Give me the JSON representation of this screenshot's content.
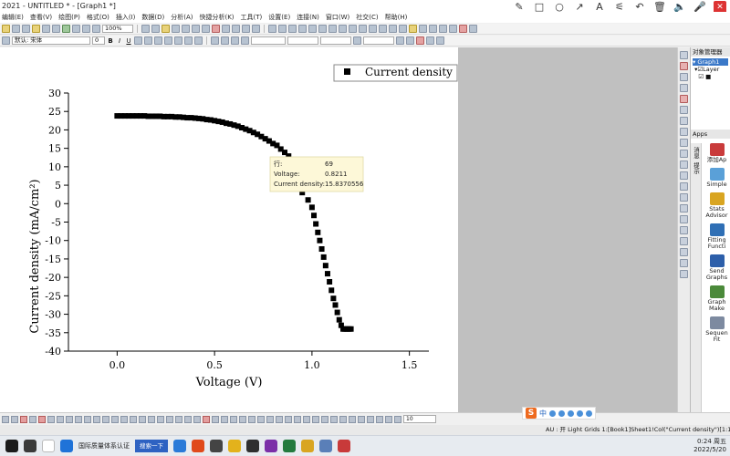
{
  "window": {
    "title": "2021 - UNTITLED * - [Graph1 *]"
  },
  "menu": [
    "编辑(E)",
    "查看(V)",
    "绘图(P)",
    "格式(O)",
    "插入(I)",
    "数据(D)",
    "分析(A)",
    "快捷分析(K)",
    "工具(T)",
    "设置(E)",
    "连接(N)",
    "窗口(W)",
    "社交(C)",
    "帮助(H)"
  ],
  "annotation_tools": [
    "✎",
    "□",
    "○",
    "↗",
    "A",
    "⚟",
    "↶",
    "🗑",
    "🔈",
    "🎤"
  ],
  "toolbar": {
    "zoom": "100%",
    "font": "默认: 宋体",
    "font_size": "0",
    "bold": "B",
    "italic": "I",
    "underline": "U"
  },
  "graph": {
    "legend": "Current density",
    "tooltip": {
      "row_label": "行:",
      "row_value": "69",
      "x_label": "Voltage:",
      "x_value": "0.8211",
      "y_label": "Current density:",
      "y_value": "15.8370556"
    }
  },
  "chart_data": {
    "type": "scatter",
    "xlabel": "Voltage (V)",
    "ylabel": "Current density (mA/cm²)",
    "xlim": [
      -0.25,
      1.6
    ],
    "ylim": [
      -40,
      30
    ],
    "xticks": [
      0.0,
      0.5,
      1.0,
      1.5
    ],
    "xtick_labels": [
      "0.0",
      "0.5",
      "1.0",
      "1.5"
    ],
    "yticks": [
      -40,
      -35,
      -30,
      -25,
      -20,
      -15,
      -10,
      -5,
      0,
      5,
      10,
      15,
      20,
      25,
      30
    ],
    "marker": "square",
    "series": [
      {
        "name": "Current density",
        "color": "#000000",
        "x": [
          0.0,
          0.02,
          0.04,
          0.06,
          0.08,
          0.1,
          0.12,
          0.14,
          0.16,
          0.18,
          0.2,
          0.22,
          0.24,
          0.26,
          0.28,
          0.3,
          0.32,
          0.34,
          0.36,
          0.38,
          0.4,
          0.42,
          0.44,
          0.46,
          0.48,
          0.5,
          0.52,
          0.54,
          0.56,
          0.58,
          0.6,
          0.62,
          0.64,
          0.66,
          0.68,
          0.7,
          0.72,
          0.74,
          0.76,
          0.78,
          0.8,
          0.82,
          0.84,
          0.86,
          0.88,
          0.9,
          0.92,
          0.95,
          0.98,
          1.0,
          1.01,
          1.02,
          1.03,
          1.04,
          1.05,
          1.06,
          1.07,
          1.08,
          1.09,
          1.1,
          1.11,
          1.12,
          1.13,
          1.14,
          1.15,
          1.16,
          1.17,
          1.18,
          1.19,
          1.2
        ],
        "y": [
          23.8,
          23.8,
          23.8,
          23.8,
          23.8,
          23.8,
          23.8,
          23.8,
          23.7,
          23.7,
          23.7,
          23.7,
          23.6,
          23.6,
          23.6,
          23.5,
          23.5,
          23.4,
          23.3,
          23.3,
          23.2,
          23.1,
          23.0,
          22.8,
          22.7,
          22.5,
          22.3,
          22.1,
          21.8,
          21.6,
          21.3,
          21.0,
          20.6,
          20.2,
          19.8,
          19.3,
          18.8,
          18.2,
          17.6,
          17.0,
          16.3,
          15.8,
          14.8,
          13.9,
          12.9,
          11.8,
          6.0,
          3.0,
          1.0,
          -1.0,
          -3.2,
          -5.5,
          -7.8,
          -10.0,
          -12.3,
          -14.5,
          -16.8,
          -19.0,
          -21.2,
          -23.5,
          -25.7,
          -27.5,
          -29.5,
          -31.5,
          -33.0,
          -34.0,
          -34.0,
          -34.0,
          -34.0,
          -34.0
        ]
      }
    ]
  },
  "object_manager": {
    "title": "对象管理器",
    "graph": "Graph1",
    "layer": "Layer"
  },
  "apps": {
    "title": "Apps",
    "side_tabs": [
      "消息",
      "提示"
    ],
    "items": [
      {
        "label": "添加Ap",
        "color": "#c93b3b"
      },
      {
        "label": "Simple",
        "color": "#5aa0d8"
      },
      {
        "label": "Stats Advisor",
        "color": "#d9a521"
      },
      {
        "label": "Fitting Functi",
        "color": "#2f6fb5"
      },
      {
        "label": "Send Graphs",
        "color": "#2d5faa"
      },
      {
        "label": "Graph Make",
        "color": "#4b8a3a"
      },
      {
        "label": "Sequen Fit",
        "color": "#7d8aa0"
      }
    ]
  },
  "bottom_toolbar": {
    "size_box": "10"
  },
  "ime": {
    "logo": "S",
    "lang": "中"
  },
  "status": {
    "text": "AU : 开  Light Grids  1:[Book1]Sheet1!Col(\"Current density\")[1:100]  1:[Grap"
  },
  "taskbar": {
    "app_label": "国际质量体系认证",
    "search_label": "搜索一下",
    "time": "0:24 周五",
    "date": "2022/5/20"
  },
  "colors": {
    "accent": "#3a78c8",
    "tooltip_bg": "#fdf8d8",
    "grey_panel": "#c0c0c0"
  }
}
